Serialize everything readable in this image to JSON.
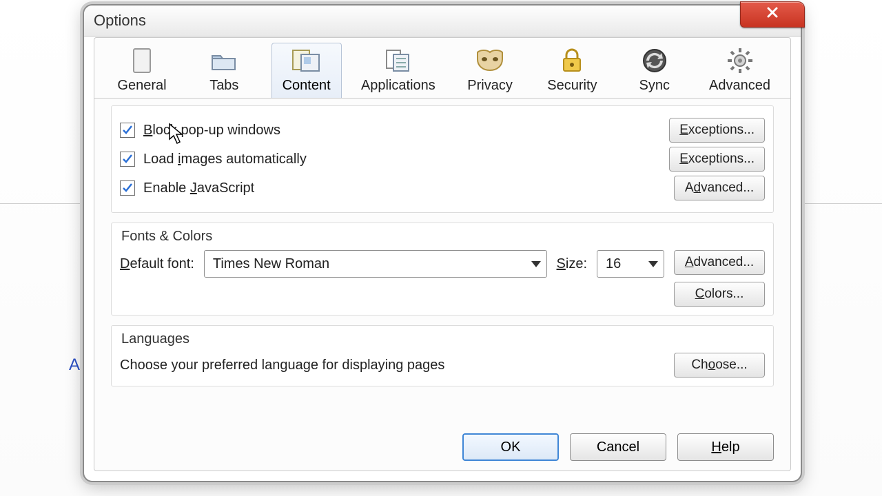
{
  "window": {
    "title": "Options"
  },
  "tabs": [
    {
      "id": "general",
      "label": "General"
    },
    {
      "id": "tabs",
      "label": "Tabs"
    },
    {
      "id": "content",
      "label": "Content",
      "active": true
    },
    {
      "id": "applications",
      "label": "Applications"
    },
    {
      "id": "privacy",
      "label": "Privacy"
    },
    {
      "id": "security",
      "label": "Security"
    },
    {
      "id": "sync",
      "label": "Sync"
    },
    {
      "id": "advanced",
      "label": "Advanced"
    }
  ],
  "content": {
    "checkboxes": [
      {
        "id": "block-popups",
        "label": "Block pop-up windows",
        "checked": true,
        "button": "Exceptions..."
      },
      {
        "id": "load-images",
        "label": "Load images automatically",
        "checked": true,
        "button": "Exceptions..."
      },
      {
        "id": "enable-js",
        "label": "Enable JavaScript",
        "checked": true,
        "button": "Advanced..."
      }
    ],
    "fonts": {
      "title": "Fonts & Colors",
      "default_font_label": "Default font:",
      "default_font_value": "Times New Roman",
      "size_label": "Size:",
      "size_value": "16",
      "advanced_button": "Advanced...",
      "colors_button": "Colors..."
    },
    "languages": {
      "title": "Languages",
      "desc": "Choose your preferred language for displaying pages",
      "choose_button": "Choose..."
    }
  },
  "footer": {
    "ok": "OK",
    "cancel": "Cancel",
    "help": "Help"
  }
}
